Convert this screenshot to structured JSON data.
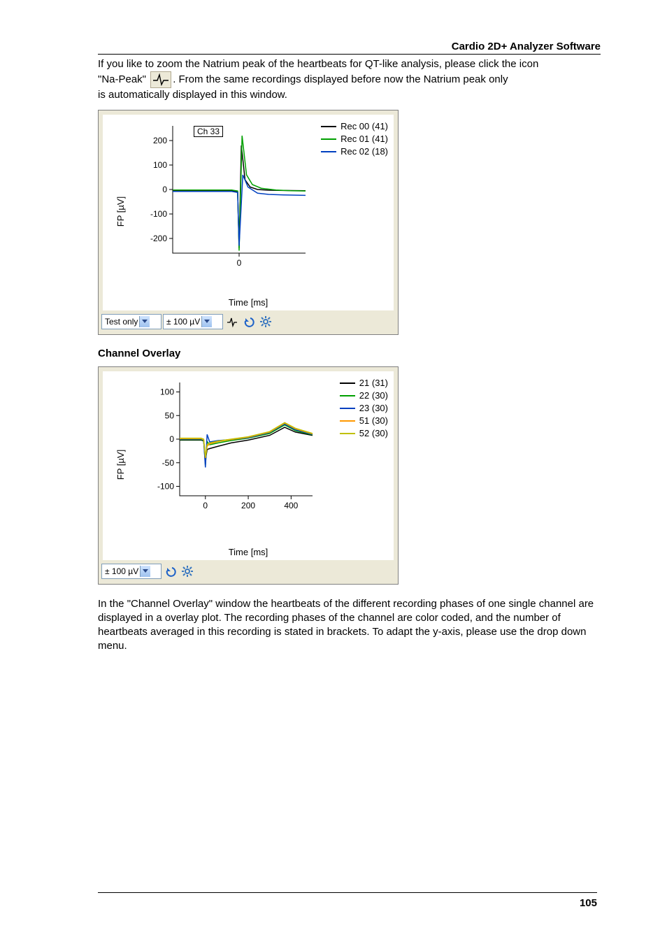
{
  "header": {
    "title": "Cardio 2D+ Analyzer Software"
  },
  "para1": {
    "line1": "If you like to zoom the Natrium peak of the heartbeats for QT-like analysis, please click the icon",
    "prefix": "\"Na-Peak\" ",
    "suffix": ". From the same recordings displayed before now the Natrium peak only",
    "line3": "is automatically displayed in this window."
  },
  "chart1": {
    "type": "line",
    "channel_label": "Ch 33",
    "ylabel": "FP [µV]",
    "xlabel": "Time [ms]",
    "yticks": [
      -200,
      -100,
      0,
      100,
      200
    ],
    "xticks": [
      0
    ],
    "xlim": [
      -90,
      90
    ],
    "ylim": [
      -260,
      260
    ],
    "legend": [
      {
        "label": "Rec 00 (41)",
        "color": "#000000"
      },
      {
        "label": "Rec 01 (41)",
        "color": "#00a000"
      },
      {
        "label": "Rec 02 (18)",
        "color": "#0040c0"
      }
    ],
    "series": [
      {
        "name": "Rec 00 (41)",
        "color": "#000000",
        "points": [
          [
            -90,
            -5
          ],
          [
            -40,
            -5
          ],
          [
            -20,
            -5
          ],
          [
            -10,
            -5
          ],
          [
            -2,
            -10
          ],
          [
            0,
            -240
          ],
          [
            3,
            180
          ],
          [
            8,
            40
          ],
          [
            15,
            10
          ],
          [
            25,
            0
          ],
          [
            40,
            -3
          ],
          [
            60,
            -4
          ],
          [
            90,
            -5
          ]
        ]
      },
      {
        "name": "Rec 01 (41)",
        "color": "#00a000",
        "points": [
          [
            -90,
            -2
          ],
          [
            -40,
            -2
          ],
          [
            -20,
            -2
          ],
          [
            -10,
            -2
          ],
          [
            -2,
            -6
          ],
          [
            0,
            -250
          ],
          [
            4,
            220
          ],
          [
            10,
            60
          ],
          [
            18,
            20
          ],
          [
            30,
            5
          ],
          [
            50,
            -2
          ],
          [
            70,
            -5
          ],
          [
            90,
            -6
          ]
        ]
      },
      {
        "name": "Rec 02 (18)",
        "color": "#0040c0",
        "points": [
          [
            -90,
            -8
          ],
          [
            -40,
            -8
          ],
          [
            -20,
            -8
          ],
          [
            -10,
            -8
          ],
          [
            -2,
            -12
          ],
          [
            0,
            -230
          ],
          [
            5,
            60
          ],
          [
            12,
            10
          ],
          [
            25,
            -15
          ],
          [
            40,
            -20
          ],
          [
            60,
            -22
          ],
          [
            90,
            -24
          ]
        ]
      }
    ],
    "toolbar": {
      "preset": "Test only",
      "yaxis": "± 100 µV"
    }
  },
  "section_heading": "Channel Overlay",
  "chart2": {
    "type": "line",
    "ylabel": "FP [µV]",
    "xlabel": "Time [ms]",
    "yticks": [
      -100,
      -50,
      0,
      50,
      100
    ],
    "xticks": [
      0,
      200,
      400
    ],
    "xlim": [
      -120,
      500
    ],
    "ylim": [
      -120,
      120
    ],
    "legend": [
      {
        "label": "21  (31)",
        "color": "#000000"
      },
      {
        "label": "22  (30)",
        "color": "#00a000"
      },
      {
        "label": "23  (30)",
        "color": "#0040c0"
      },
      {
        "label": "51  (30)",
        "color": "#ff9900"
      },
      {
        "label": "52  (30)",
        "color": "#c0c000"
      }
    ],
    "series": [
      {
        "name": "21",
        "color": "#000000",
        "points": [
          [
            -120,
            -2
          ],
          [
            -20,
            -2
          ],
          [
            -8,
            -4
          ],
          [
            0,
            -45
          ],
          [
            8,
            -22
          ],
          [
            20,
            -20
          ],
          [
            60,
            -15
          ],
          [
            120,
            -8
          ],
          [
            200,
            -2
          ],
          [
            300,
            8
          ],
          [
            370,
            25
          ],
          [
            420,
            15
          ],
          [
            500,
            8
          ]
        ]
      },
      {
        "name": "22",
        "color": "#00a000",
        "points": [
          [
            -120,
            -1
          ],
          [
            -20,
            -1
          ],
          [
            -8,
            -3
          ],
          [
            0,
            -55
          ],
          [
            8,
            -5
          ],
          [
            20,
            -12
          ],
          [
            60,
            -8
          ],
          [
            120,
            -3
          ],
          [
            200,
            2
          ],
          [
            300,
            12
          ],
          [
            370,
            30
          ],
          [
            420,
            18
          ],
          [
            500,
            9
          ]
        ]
      },
      {
        "name": "23",
        "color": "#0040c0",
        "points": [
          [
            -120,
            0
          ],
          [
            -20,
            0
          ],
          [
            -8,
            -2
          ],
          [
            0,
            -60
          ],
          [
            8,
            10
          ],
          [
            20,
            -6
          ],
          [
            60,
            -3
          ],
          [
            120,
            -1
          ],
          [
            200,
            3
          ],
          [
            300,
            14
          ],
          [
            370,
            32
          ],
          [
            420,
            20
          ],
          [
            500,
            10
          ]
        ]
      },
      {
        "name": "51",
        "color": "#ff9900",
        "points": [
          [
            -120,
            1
          ],
          [
            -20,
            1
          ],
          [
            -8,
            -1
          ],
          [
            0,
            -40
          ],
          [
            8,
            -15
          ],
          [
            20,
            -10
          ],
          [
            60,
            -5
          ],
          [
            120,
            -1
          ],
          [
            200,
            4
          ],
          [
            300,
            15
          ],
          [
            370,
            34
          ],
          [
            420,
            22
          ],
          [
            500,
            11
          ]
        ]
      },
      {
        "name": "52",
        "color": "#c0c000",
        "points": [
          [
            -120,
            2
          ],
          [
            -20,
            2
          ],
          [
            -8,
            0
          ],
          [
            0,
            -38
          ],
          [
            8,
            -12
          ],
          [
            20,
            -8
          ],
          [
            60,
            -4
          ],
          [
            120,
            0
          ],
          [
            200,
            5
          ],
          [
            300,
            16
          ],
          [
            370,
            35
          ],
          [
            420,
            23
          ],
          [
            500,
            12
          ]
        ]
      }
    ],
    "toolbar": {
      "yaxis": "± 100 µV"
    }
  },
  "para2": "In the \"Channel Overlay\" window the heartbeats of the different recording phases of one single channel are displayed in a overlay plot. The recording phases of the channel are color coded, and the number of heartbeats averaged in this recording is stated in brackets. To adapt the y-axis, please use the drop down menu.",
  "footer": {
    "page": "105"
  },
  "chart_data": [
    {
      "type": "line",
      "title": "Ch 33 Na-Peak",
      "xlabel": "Time [ms]",
      "ylabel": "FP [µV]",
      "xlim": [
        -90,
        90
      ],
      "ylim": [
        -260,
        260
      ],
      "series": [
        {
          "name": "Rec 00 (41)",
          "x": [
            -90,
            -40,
            -20,
            -10,
            -2,
            0,
            3,
            8,
            15,
            25,
            40,
            60,
            90
          ],
          "y": [
            -5,
            -5,
            -5,
            -5,
            -10,
            -240,
            180,
            40,
            10,
            0,
            -3,
            -4,
            -5
          ]
        },
        {
          "name": "Rec 01 (41)",
          "x": [
            -90,
            -40,
            -20,
            -10,
            -2,
            0,
            4,
            10,
            18,
            30,
            50,
            70,
            90
          ],
          "y": [
            -2,
            -2,
            -2,
            -2,
            -6,
            -250,
            220,
            60,
            20,
            5,
            -2,
            -5,
            -6
          ]
        },
        {
          "name": "Rec 02 (18)",
          "x": [
            -90,
            -40,
            -20,
            -10,
            -2,
            0,
            5,
            12,
            25,
            40,
            60,
            90
          ],
          "y": [
            -8,
            -8,
            -8,
            -8,
            -12,
            -230,
            60,
            10,
            -15,
            -20,
            -22,
            -24
          ]
        }
      ]
    },
    {
      "type": "line",
      "title": "Channel Overlay",
      "xlabel": "Time [ms]",
      "ylabel": "FP [µV]",
      "xlim": [
        -120,
        500
      ],
      "ylim": [
        -120,
        120
      ],
      "series": [
        {
          "name": "21 (31)",
          "x": [
            -120,
            -20,
            -8,
            0,
            8,
            20,
            60,
            120,
            200,
            300,
            370,
            420,
            500
          ],
          "y": [
            -2,
            -2,
            -4,
            -45,
            -22,
            -20,
            -15,
            -8,
            -2,
            8,
            25,
            15,
            8
          ]
        },
        {
          "name": "22 (30)",
          "x": [
            -120,
            -20,
            -8,
            0,
            8,
            20,
            60,
            120,
            200,
            300,
            370,
            420,
            500
          ],
          "y": [
            -1,
            -1,
            -3,
            -55,
            -5,
            -12,
            -8,
            -3,
            2,
            12,
            30,
            18,
            9
          ]
        },
        {
          "name": "23 (30)",
          "x": [
            -120,
            -20,
            -8,
            0,
            8,
            20,
            60,
            120,
            200,
            300,
            370,
            420,
            500
          ],
          "y": [
            0,
            0,
            -2,
            -60,
            10,
            -6,
            -3,
            -1,
            3,
            14,
            32,
            20,
            10
          ]
        },
        {
          "name": "51 (30)",
          "x": [
            -120,
            -20,
            -8,
            0,
            8,
            20,
            60,
            120,
            200,
            300,
            370,
            420,
            500
          ],
          "y": [
            1,
            1,
            -1,
            -40,
            -15,
            -10,
            -5,
            -1,
            4,
            15,
            34,
            22,
            11
          ]
        },
        {
          "name": "52 (30)",
          "x": [
            -120,
            -20,
            -8,
            0,
            8,
            20,
            60,
            120,
            200,
            300,
            370,
            420,
            500
          ],
          "y": [
            2,
            2,
            0,
            -38,
            -12,
            -8,
            -4,
            0,
            5,
            16,
            35,
            23,
            12
          ]
        }
      ]
    }
  ]
}
